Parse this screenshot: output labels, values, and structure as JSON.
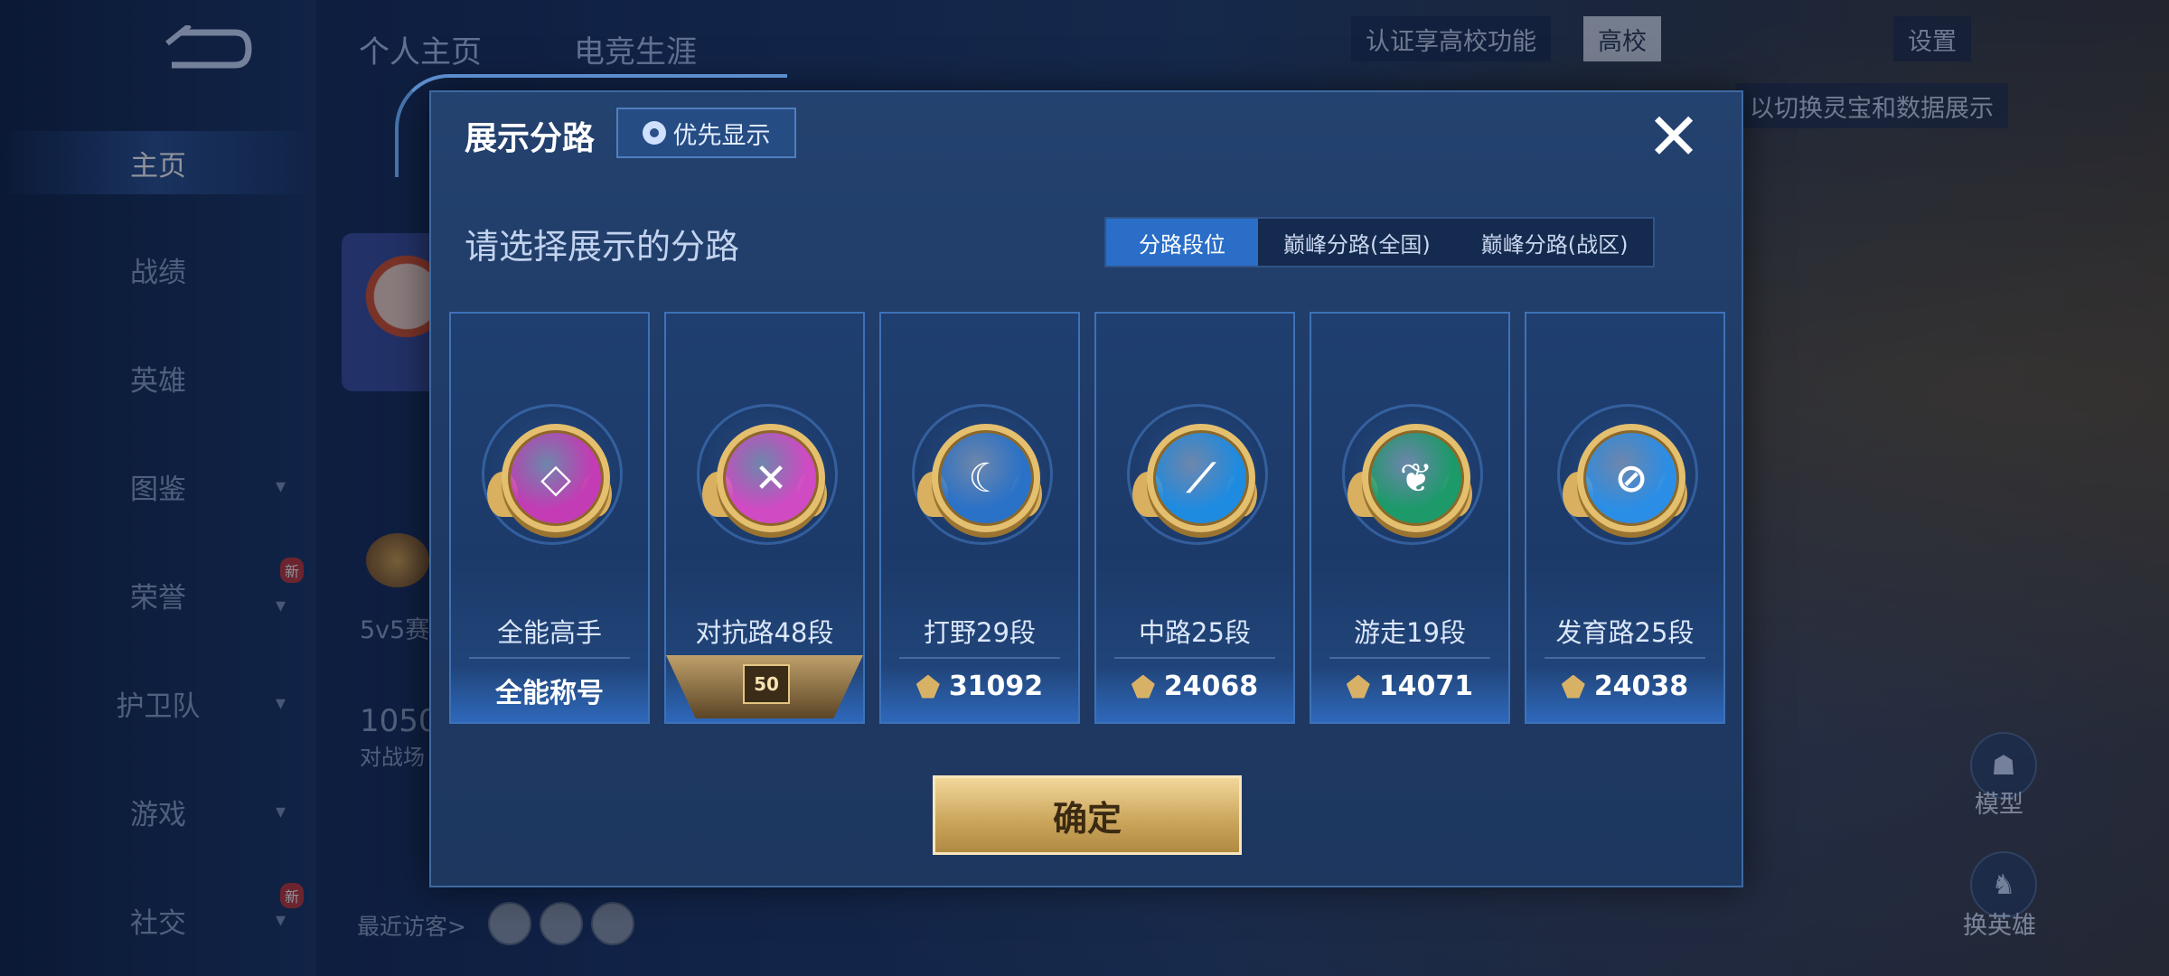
{
  "nav": {
    "items": [
      {
        "label": "主页",
        "active": true
      },
      {
        "label": "战绩"
      },
      {
        "label": "英雄"
      },
      {
        "label": "图鉴",
        "chevron": "▾"
      },
      {
        "label": "荣誉",
        "chevron": "▾",
        "badge": "新"
      },
      {
        "label": "护卫队",
        "chevron": "▾"
      },
      {
        "label": "游戏",
        "chevron": "▾"
      },
      {
        "label": "社交",
        "chevron": "▾",
        "badge": "新"
      }
    ]
  },
  "profile": {
    "tabs": [
      "个人主页",
      "电竞生涯"
    ],
    "text_5v5": "5v5赛",
    "num_1050": "1050",
    "battle_text": "对战场",
    "recent_visitors": "最近访客>"
  },
  "top_right": {
    "campus": "认证享高校功能",
    "campus_chip": "高校",
    "settings": "设置",
    "hint": "以切换灵宝和数据展示"
  },
  "right_buttons": {
    "model": "模型",
    "change_hero": "换英雄"
  },
  "modal": {
    "title": "展示分路",
    "priority_label": "优先显示",
    "close": "✕",
    "subtitle": "请选择展示的分路",
    "segments": [
      "分路段位",
      "巅峰分路(全国)",
      "巅峰分路(战区)"
    ],
    "active_segment": 0,
    "cards": [
      {
        "label": "全能高手",
        "value": "全能称号",
        "emblem": "all-round-icon",
        "emblem_color": "#c33cb5",
        "glyph": "◇"
      },
      {
        "label": "对抗路48段",
        "level": "50",
        "emblem": "clash-lane-icon",
        "emblem_color": "#d04ac4",
        "glyph": "✕"
      },
      {
        "label": "打野29段",
        "value": "31092",
        "emblem": "jungle-icon",
        "emblem_color": "#2a72c8",
        "glyph": "☾"
      },
      {
        "label": "中路25段",
        "value": "24068",
        "emblem": "mid-lane-icon",
        "emblem_color": "#1f8be0",
        "glyph": "⟋"
      },
      {
        "label": "游走19段",
        "value": "14071",
        "emblem": "roam-icon",
        "emblem_color": "#1c9a6a",
        "glyph": "❦"
      },
      {
        "label": "发育路25段",
        "value": "24038",
        "emblem": "farm-lane-icon",
        "emblem_color": "#2b8ee6",
        "glyph": "⊘"
      }
    ],
    "confirm": "确定"
  }
}
